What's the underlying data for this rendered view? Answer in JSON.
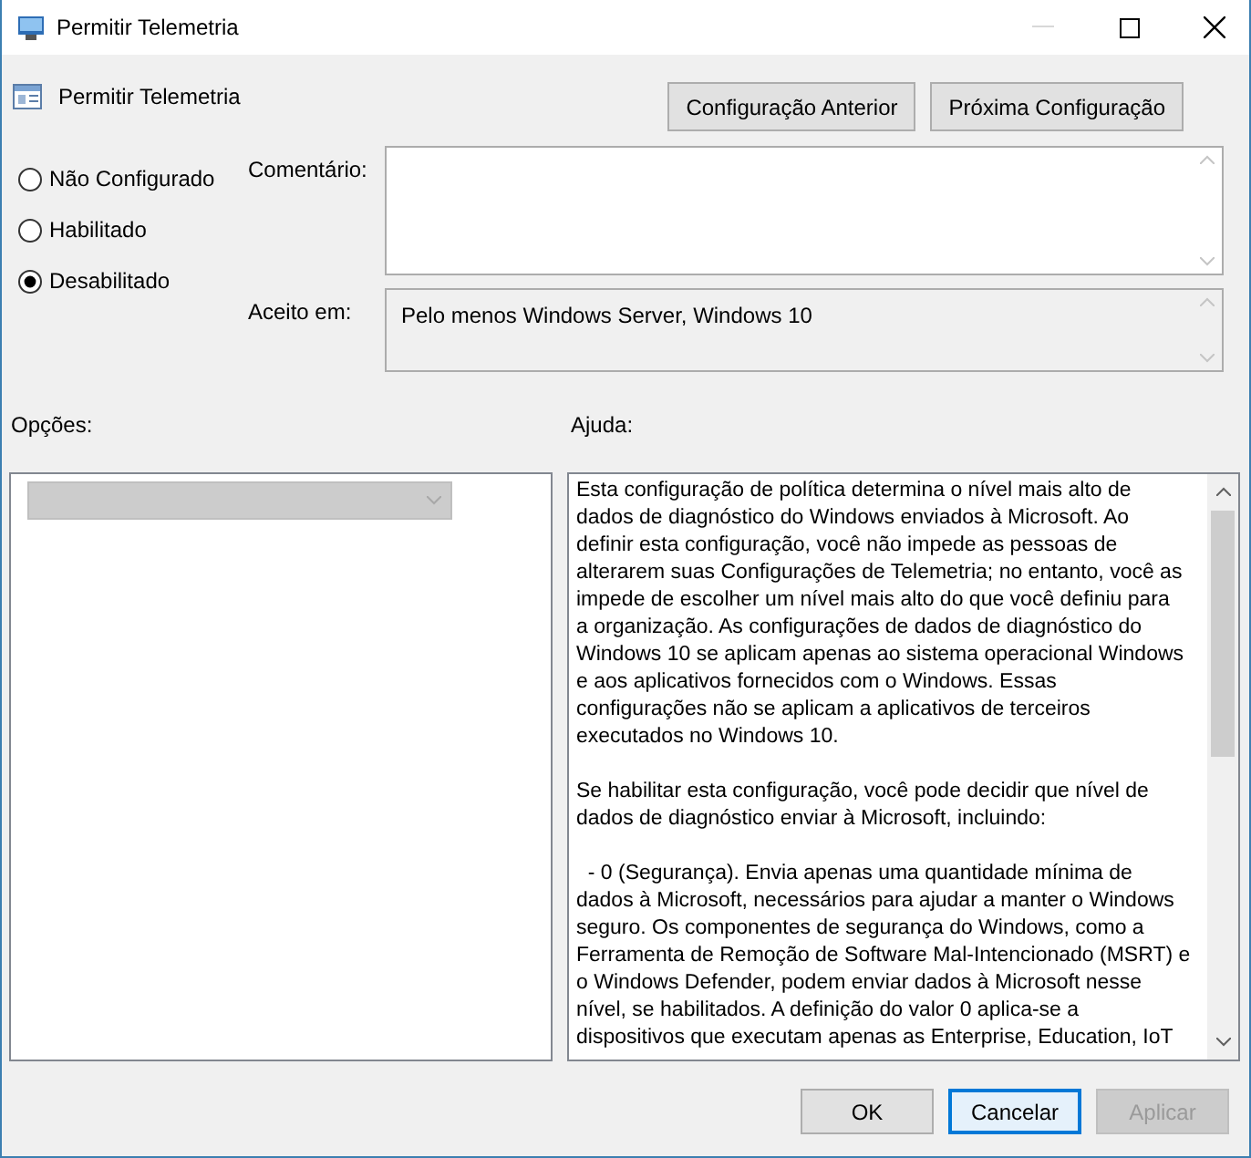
{
  "window": {
    "title": "Permitir Telemetria"
  },
  "header": {
    "title": "Permitir Telemetria"
  },
  "nav_buttons": [
    {
      "label": "Configuração Anterior"
    },
    {
      "label": "Próxima Configuração"
    }
  ],
  "state_options": [
    {
      "label": "Não Configurado",
      "selected": false
    },
    {
      "label": "Habilitado",
      "selected": false
    },
    {
      "label": "Desabilitado",
      "selected": true
    }
  ],
  "comment": {
    "label": "Comentário:"
  },
  "supported_on": {
    "label": "Aceito em:",
    "value": "Pelo menos Windows Server, Windows 10"
  },
  "options": {
    "label": "Opções:",
    "dropdown": {
      "disabled": true
    }
  },
  "help": {
    "label": "Ajuda:",
    "paragraphs": [
      [
        "Esta configuração de política determina o nível mais alto de",
        "dados de diagnóstico do Windows enviados à Microsoft. Ao",
        "definir esta configuração, você não impede as pessoas de",
        "alterarem suas Configurações de Telemetria; no entanto, você as",
        "impede de escolher um nível mais alto do que você definiu para",
        "a organização. As configurações de dados de diagnóstico do",
        "Windows 10 se aplicam apenas ao sistema operacional Windows",
        "e aos aplicativos fornecidos com o Windows. Essas",
        "configurações não se aplicam a aplicativos de terceiros",
        "executados no Windows 10."
      ],
      [
        "Se habilitar esta configuração, você pode decidir que nível de",
        "dados de diagnóstico enviar à Microsoft, incluindo:"
      ],
      [
        "  - 0 (Segurança). Envia apenas uma quantidade mínima de",
        "dados à Microsoft, necessários para ajudar a manter o Windows",
        "seguro. Os componentes de segurança do Windows, como a",
        "Ferramenta de Remoção de Software Mal-Intencionado (MSRT) e",
        "o Windows Defender, podem enviar dados à Microsoft nesse",
        "nível, se habilitados. A definição do valor 0 aplica-se a",
        "dispositivos que executam apenas as Enterprise, Education, IoT"
      ]
    ]
  },
  "footer_buttons": [
    {
      "label": "OK",
      "focused": false,
      "disabled": false
    },
    {
      "label": "Cancelar",
      "focused": true,
      "disabled": false
    },
    {
      "label": "Aplicar",
      "focused": false,
      "disabled": true
    }
  ]
}
